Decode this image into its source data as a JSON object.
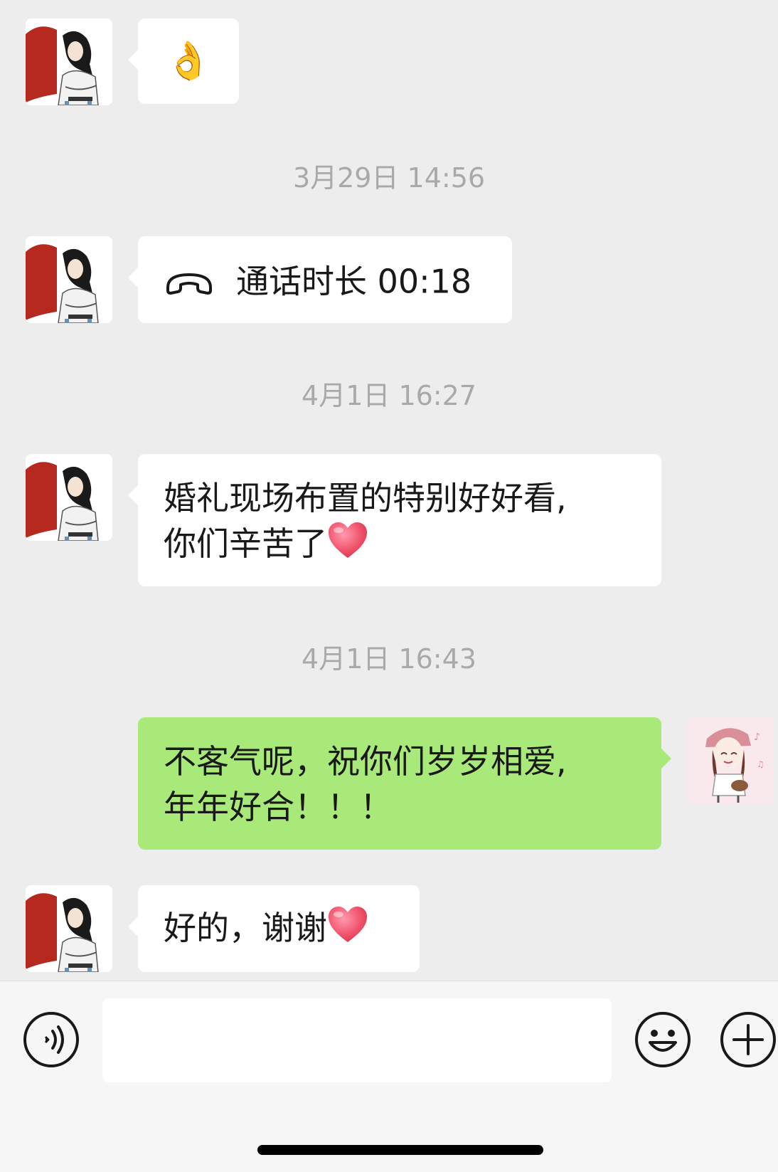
{
  "colors": {
    "background": "#EDEDED",
    "bubble_incoming": "#FFFFFF",
    "bubble_outgoing": "#A8E97A",
    "timestamp_text": "#A9A9A9",
    "avatar_heart_red": "#B5291E"
  },
  "messages": [
    {
      "type": "emoji",
      "direction": "incoming",
      "icon": "ok-hand-emoji",
      "text": "👌"
    },
    {
      "type": "timestamp",
      "text": "3月29日 14:56"
    },
    {
      "type": "call",
      "direction": "incoming",
      "icon": "phone-hangup-icon",
      "text": "通话时长 00:18"
    },
    {
      "type": "timestamp",
      "text": "4月1日 16:27"
    },
    {
      "type": "text",
      "direction": "incoming",
      "lines": [
        "婚礼现场布置的特别好好看,",
        "你们辛苦了"
      ],
      "trailing_icon": "red-heart-emoji"
    },
    {
      "type": "timestamp",
      "text": "4月1日 16:43"
    },
    {
      "type": "text",
      "direction": "outgoing",
      "lines": [
        "不客气呢，祝你们岁岁相爱,",
        "年年好合！！！"
      ]
    },
    {
      "type": "text",
      "direction": "incoming",
      "text": "好的，谢谢",
      "trailing_icon": "red-heart-emoji"
    }
  ],
  "input_bar": {
    "voice_button_icon": "voice-icon",
    "text_value": "",
    "emoji_button_icon": "smiley-icon",
    "more_button_icon": "plus-icon"
  }
}
